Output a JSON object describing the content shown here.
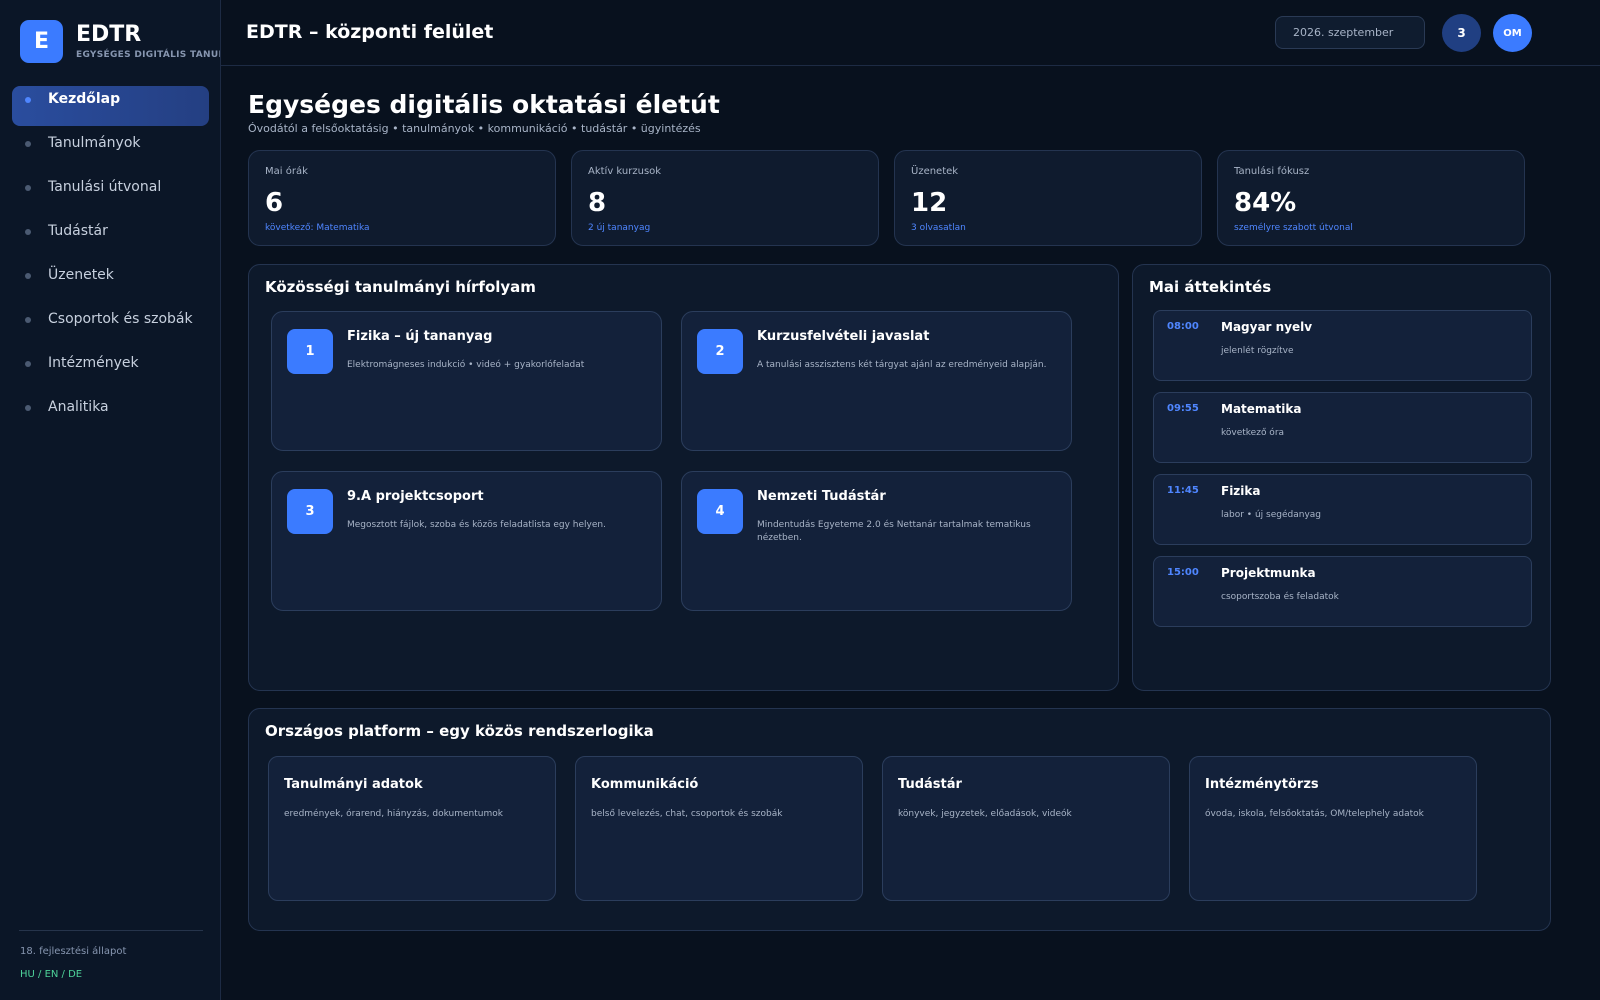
{
  "brand": {
    "logo_letter": "E",
    "name": "EDTR",
    "subtitle": "EGYSÉGES DIGITÁLIS TANULMÁNYI RENDSZER"
  },
  "sidebar": {
    "items": [
      {
        "label": "Kezdőlap",
        "active": true
      },
      {
        "label": "Tanulmányok",
        "active": false
      },
      {
        "label": "Tanulási útvonal",
        "active": false
      },
      {
        "label": "Tudástár",
        "active": false
      },
      {
        "label": "Üzenetek",
        "active": false
      },
      {
        "label": "Csoportok és szobák",
        "active": false
      },
      {
        "label": "Intézmények",
        "active": false
      },
      {
        "label": "Analitika",
        "active": false
      }
    ],
    "dev_status": "18. fejlesztési állapot",
    "languages": "HU / EN / DE"
  },
  "topbar": {
    "title": "EDTR – központi felület",
    "date": "2026. szeptember",
    "notifications": "3",
    "avatar": "OM"
  },
  "page": {
    "title": "Egységes digitális oktatási életút",
    "subtitle": "Óvodától a felsőoktatásig • tanulmányok • kommunikáció • tudástár • ügyintézés"
  },
  "stats": [
    {
      "label": "Mai órák",
      "value": "6",
      "note": "következő: Matematika"
    },
    {
      "label": "Aktív kurzusok",
      "value": "8",
      "note": "2 új tananyag"
    },
    {
      "label": "Üzenetek",
      "value": "12",
      "note": "3 olvasatlan"
    },
    {
      "label": "Tanulási fókusz",
      "value": "84%",
      "note": "személyre szabott útvonal"
    }
  ],
  "feed": {
    "title": "Közösségi tanulmányi hírfolyam",
    "items": [
      {
        "num": "1",
        "title": "Fizika – új tananyag",
        "desc": "Elektromágneses indukció • videó + gyakorlófeladat"
      },
      {
        "num": "2",
        "title": "Kurzusfelvételi javaslat",
        "desc": "A tanulási asszisztens két tárgyat ajánl az eredményeid alapján."
      },
      {
        "num": "3",
        "title": "9.A projektcsoport",
        "desc": "Megosztott fájlok, szoba és közös feladatlista egy helyen."
      },
      {
        "num": "4",
        "title": "Nemzeti Tudástár",
        "desc": "Mindentudás Egyeteme 2.0 és Nettanár tartalmak tematikus nézetben."
      }
    ]
  },
  "overview": {
    "title": "Mai áttekintés",
    "items": [
      {
        "time": "08:00",
        "title": "Magyar nyelv",
        "sub": "jelenlét rögzítve"
      },
      {
        "time": "09:55",
        "title": "Matematika",
        "sub": "következő óra"
      },
      {
        "time": "11:45",
        "title": "Fizika",
        "sub": "labor • új segédanyag"
      },
      {
        "time": "15:00",
        "title": "Projektmunka",
        "sub": "csoportszoba és feladatok"
      }
    ]
  },
  "platform": {
    "title": "Országos platform – egy közös rendszerlogika",
    "modules": [
      {
        "title": "Tanulmányi adatok",
        "desc": "eredmények, órarend, hiányzás, dokumentumok"
      },
      {
        "title": "Kommunikáció",
        "desc": "belső levelezés, chat, csoportok és szobák"
      },
      {
        "title": "Tudástár",
        "desc": "könyvek, jegyzetek, előadások, videók"
      },
      {
        "title": "Intézménytörzs",
        "desc": "óvoda, iskola, felsőoktatás, OM/telephely adatok"
      }
    ]
  },
  "colors": {
    "accent": "#3b7bff",
    "background": "#08111e",
    "panel": "#0d192b",
    "card": "#13213a",
    "success_text": "#4ed39a"
  }
}
